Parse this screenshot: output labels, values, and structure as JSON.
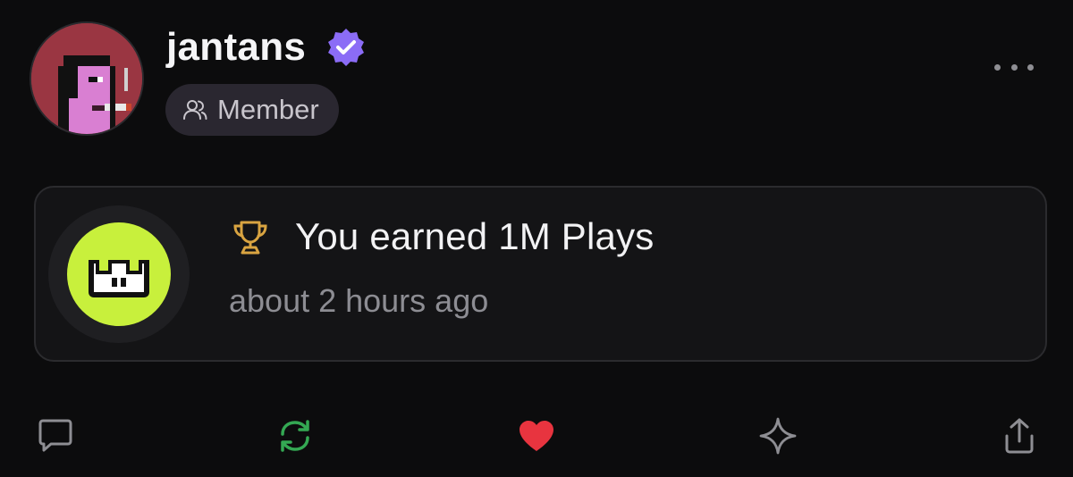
{
  "post": {
    "username": "jantans",
    "role_label": "Member",
    "verified": true,
    "avatar_background": "#9a3642"
  },
  "activity": {
    "title": "You earned 1M Plays",
    "time": "about 2 hours ago",
    "badge_color": "#c8f03c",
    "trophy_color": "#d9a441"
  },
  "icons": {
    "verified": "verified-badge-icon",
    "member": "person-icon",
    "more": "more-options-icon",
    "trophy": "trophy-icon",
    "comment": "comment-icon",
    "repost": "repost-icon",
    "like": "heart-icon",
    "highlight": "sparkle-icon",
    "share": "share-icon"
  },
  "actions": {
    "like_active": true,
    "like_color": "#e8343f",
    "repost_color": "#34a853",
    "muted_icon_color": "#8e8e93"
  },
  "colors": {
    "background": "#0c0c0d",
    "verified_badge": "#8b6cf6",
    "pill_background": "#2a2730"
  }
}
